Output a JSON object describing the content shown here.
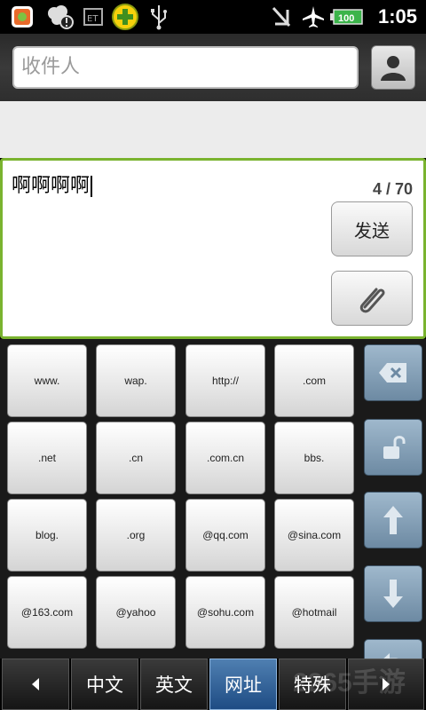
{
  "status_bar": {
    "time": "1:05",
    "battery_level": "100",
    "icons": [
      "app-icon",
      "clover-icon",
      "tool-icon",
      "plus-icon",
      "usb-icon",
      "no-signal-icon",
      "airplane-icon",
      "battery-icon"
    ]
  },
  "header": {
    "to_placeholder": "收件人"
  },
  "compose": {
    "message": "啊啊啊啊",
    "counter": "4 / 70",
    "send_label": "发送"
  },
  "keyboard": {
    "keys": [
      [
        "www.",
        "wap.",
        "http://",
        ".com"
      ],
      [
        ".net",
        ".cn",
        ".com.cn",
        "bbs."
      ],
      [
        "blog.",
        ".org",
        "@qq.com",
        "@sina.com"
      ],
      [
        "@163.com",
        "@yahoo",
        "@sohu.com",
        "@hotmail"
      ]
    ],
    "function_keys": [
      "backspace-icon",
      "unlock-icon",
      "arrow-up-icon",
      "arrow-down-icon",
      "return-icon"
    ]
  },
  "tabs": {
    "items": [
      "中文",
      "英文",
      "网址",
      "特殊"
    ],
    "active": "网址"
  },
  "watermark": "2265手游",
  "colors": {
    "accent_green": "#7ab32f",
    "active_tab": "#1e4c84",
    "function_key": "#6d8aa3"
  }
}
